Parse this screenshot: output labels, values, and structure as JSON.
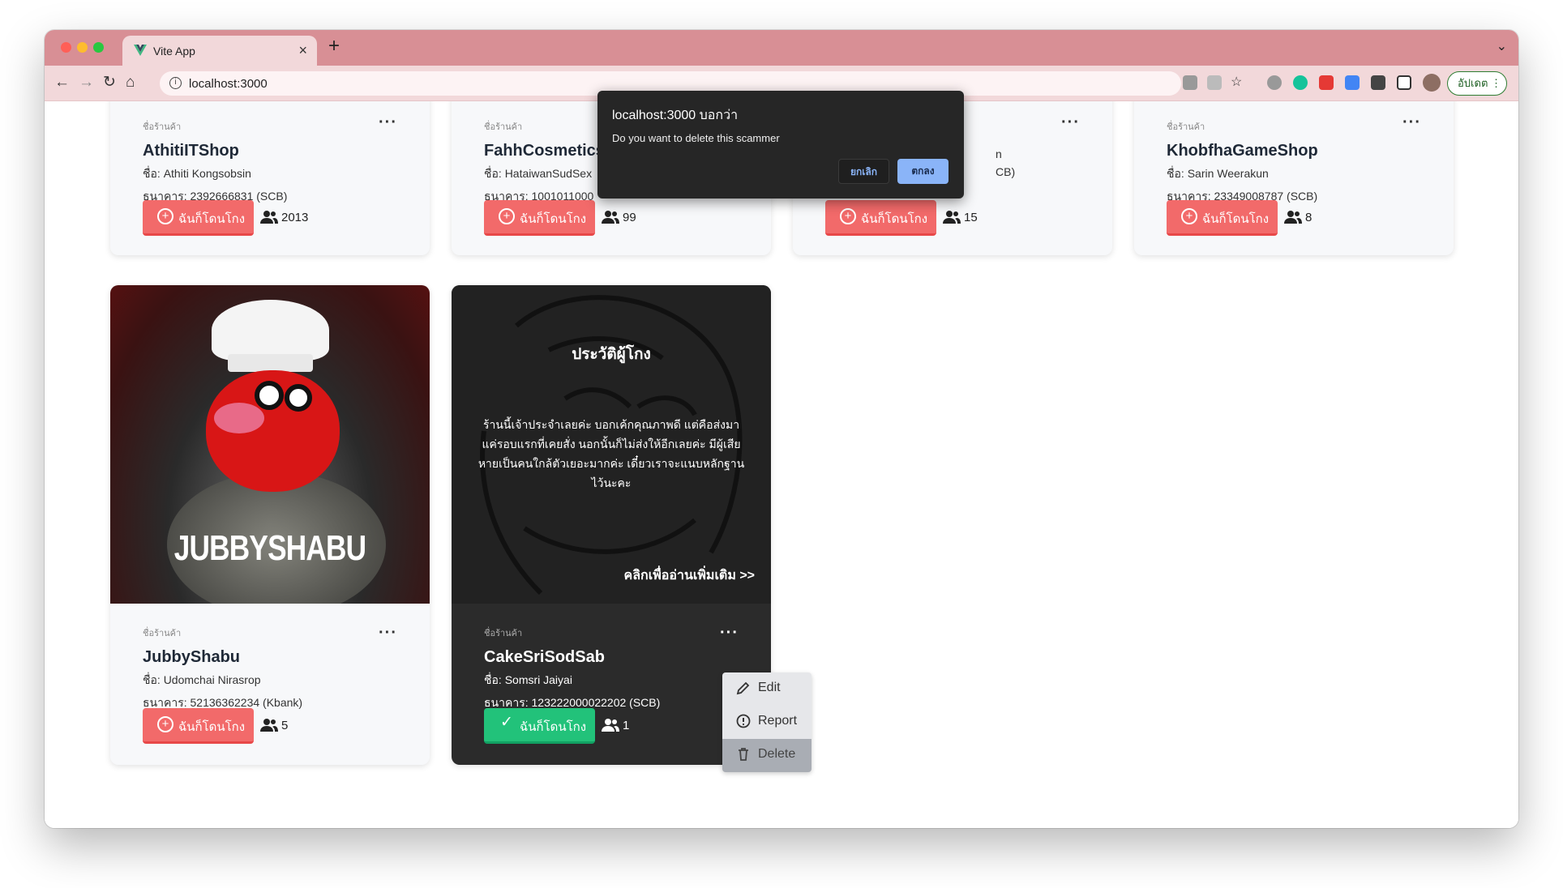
{
  "browser": {
    "tab_title": "Vite App",
    "url": "localhost:3000",
    "update_label": "อัปเดต"
  },
  "dialog": {
    "title": "localhost:3000 บอกว่า",
    "message": "Do you want to delete this scammer",
    "cancel_label": "ยกเลิก",
    "ok_label": "ตกลง"
  },
  "cards_top": [
    {
      "shop_label": "ชื่อร้านค้า",
      "shop": "AthitiITShop",
      "owner": "ชื่อ: Athiti Kongsobsin",
      "bank": "ธนาคาร: 2392666831 (SCB)",
      "button": "ฉันก็โดนโกง",
      "count": "2013"
    },
    {
      "shop_label": "ชื่อร้านค้า",
      "shop": "FahhCosmetics",
      "owner": "ชื่อ: HataiwanSudSex",
      "bank": "ธนาคาร: 1001011000",
      "button": "ฉันก็โดนโกง",
      "count": "99"
    },
    {
      "shop_label": "",
      "shop": "",
      "owner": "n",
      "bank": "CB)",
      "button": "ฉันก็โดนโกง",
      "count": "15"
    },
    {
      "shop_label": "ชื่อร้านค้า",
      "shop": "KhobfhaGameShop",
      "owner": "ชื่อ: Sarin Weerakun",
      "bank": "ธนาคาร: 23349008787 (SCB)",
      "button": "ฉันก็โดนโกง",
      "count": "8"
    }
  ],
  "card_jubby": {
    "image_text": "JUBBYSHABU",
    "shop_label": "ชื่อร้านค้า",
    "shop": "JubbyShabu",
    "owner": "ชื่อ: Udomchai Nirasrop",
    "bank": "ธนาคาร: 52136362234 (Kbank)",
    "button": "ฉันก็โดนโกง",
    "count": "5"
  },
  "card_cake": {
    "history_title": "ประวัติผู้โกง",
    "history_line1": "ร้านนี้เจ้าประจำเลยค่ะ บอกเค้กคุณภาพดี แต่คือส่งมา",
    "history_line2": "แค่รอบแรกที่เคยสั่ง นอกนั้นก็ไม่ส่งให้อีกเลยค่ะ มีผู้เสีย",
    "history_line3": "หายเป็นคนใกล้ตัวเยอะมากค่ะ เดี๋ยวเราจะแนบหลักฐาน",
    "history_line4": "ไว้นะคะ",
    "read_more": "คลิกเพื่ออ่านเพิ่มเติม >>",
    "shop_label": "ชื่อร้านค้า",
    "shop": "CakeSriSodSab",
    "owner": "ชื่อ: Somsri Jaiyai",
    "bank": "ธนาคาร: 123222000022202 (SCB)",
    "button": "ฉันก็โดนโกง",
    "count": "1"
  },
  "context_menu": {
    "edit": "Edit",
    "report": "Report",
    "delete": "Delete"
  },
  "colors": {
    "accent_red": "#f26a6a",
    "accent_green": "#22c27a",
    "titlebar": "#d88f95"
  }
}
